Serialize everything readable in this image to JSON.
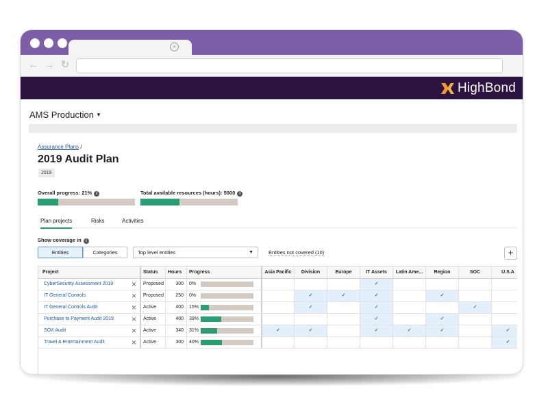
{
  "app": {
    "logo_text": "HighBond",
    "workspace": "AMS Production",
    "brand_color": "#2c1442",
    "accent_color": "#2a9d73",
    "window_color": "#7b5ea7"
  },
  "browser": {
    "nav": {
      "back_icon": "back-arrow-icon",
      "forward_icon": "forward-arrow-icon",
      "reload_icon": "reload-icon"
    },
    "url": ""
  },
  "breadcrumb": {
    "link": "Assurance Plans",
    "separator": "/"
  },
  "page": {
    "title": "2019 Audit Plan",
    "year_badge": "2019"
  },
  "metrics": {
    "overall_progress_label": "Overall progress: 21%",
    "overall_progress_value": 0.21,
    "resources_label": "Total available resources (hours): 5000",
    "resources_value": 0.4
  },
  "tabs": [
    "Plan projects",
    "Risks",
    "Activities"
  ],
  "coverage": {
    "label": "Show coverage in",
    "toggle": [
      "Entities",
      "Categories"
    ],
    "dropdown_value": "Top level entities",
    "not_covered": "Entities not covered (10)",
    "add_label": "+"
  },
  "table": {
    "headers": {
      "project": "Project",
      "status": "Status",
      "hours": "Hours",
      "progress": "Progress"
    },
    "entities": [
      "Asia Pacific",
      "Division",
      "Europe",
      "IT Assets",
      "Latin Ame...",
      "Region",
      "SOC",
      "U.S.A"
    ],
    "check": "✓",
    "remove": "✕",
    "rows": [
      {
        "project": "CyberSecurity Assessment 2019",
        "status": "Proposed",
        "hours": "300",
        "progress": "0%",
        "progress_value": 0.0,
        "coverage": [
          false,
          false,
          false,
          true,
          false,
          false,
          false,
          false
        ]
      },
      {
        "project": "IT General Controls",
        "status": "Proposed",
        "hours": "250",
        "progress": "0%",
        "progress_value": 0.0,
        "coverage": [
          false,
          true,
          true,
          true,
          false,
          true,
          false,
          false
        ]
      },
      {
        "project": "IT General Controls Audit",
        "status": "Active",
        "hours": "400",
        "progress": "15%",
        "progress_value": 0.15,
        "coverage": [
          false,
          true,
          false,
          true,
          false,
          false,
          true,
          false
        ]
      },
      {
        "project": "Purchase to Payment Audit 2019",
        "status": "Active",
        "hours": "400",
        "progress": "39%",
        "progress_value": 0.39,
        "coverage": [
          false,
          false,
          false,
          true,
          false,
          true,
          false,
          false
        ]
      },
      {
        "project": "SOX Audit",
        "status": "Active",
        "hours": "340",
        "progress": "31%",
        "progress_value": 0.31,
        "coverage": [
          true,
          true,
          false,
          true,
          true,
          true,
          false,
          true
        ]
      },
      {
        "project": "Travel & Entertainment Audit",
        "status": "Active",
        "hours": "300",
        "progress": "40%",
        "progress_value": 0.4,
        "coverage": [
          false,
          false,
          false,
          false,
          false,
          false,
          false,
          true
        ]
      }
    ]
  }
}
